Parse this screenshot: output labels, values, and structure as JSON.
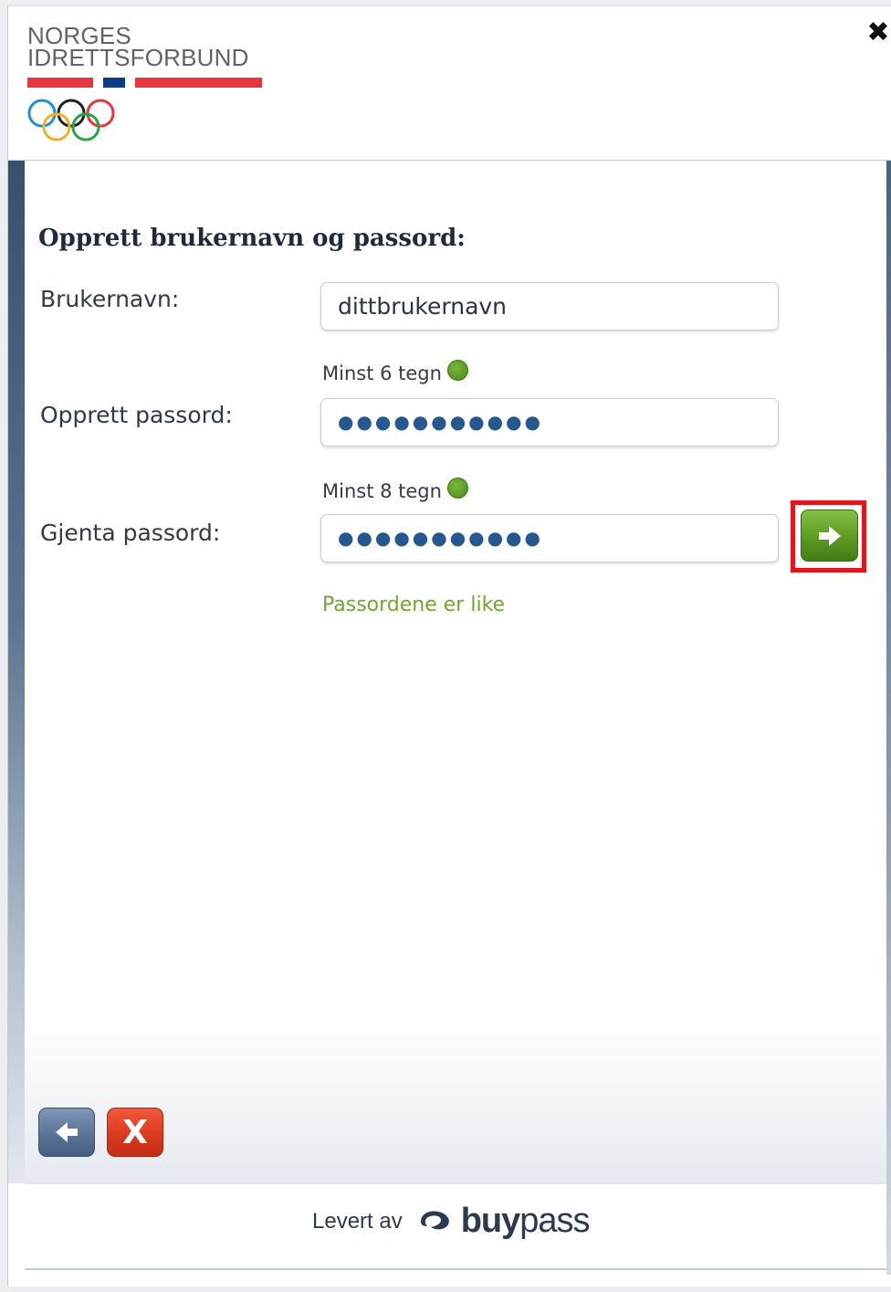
{
  "logo": {
    "line1": "NORGES",
    "line2": "IDRETTSFORBUND",
    "colors": {
      "red": "#e8363d",
      "blue": "#0b3b8a"
    }
  },
  "close_label": "✖",
  "form": {
    "heading": "Opprett brukernavn og passord:",
    "username_label": "Brukernavn:",
    "username_value": "dittbrukernavn",
    "username_hint": "Minst 6 tegn",
    "password_label": "Opprett passord:",
    "password_value": "●●●●●●●●●●●",
    "password_hint": "Minst 8 tegn",
    "repeat_label": "Gjenta passord:",
    "repeat_value": "●●●●●●●●●●●",
    "match_text": "Passordene er like",
    "status_color": "#6ea62e"
  },
  "buttons": {
    "next_icon": "arrow-right-icon",
    "back_icon": "arrow-left-icon",
    "cancel_label": "X",
    "highlight_color": "#e0161d"
  },
  "footer": {
    "provided_by": "Levert av",
    "brand_bold": "buy",
    "brand_light": "pass"
  }
}
